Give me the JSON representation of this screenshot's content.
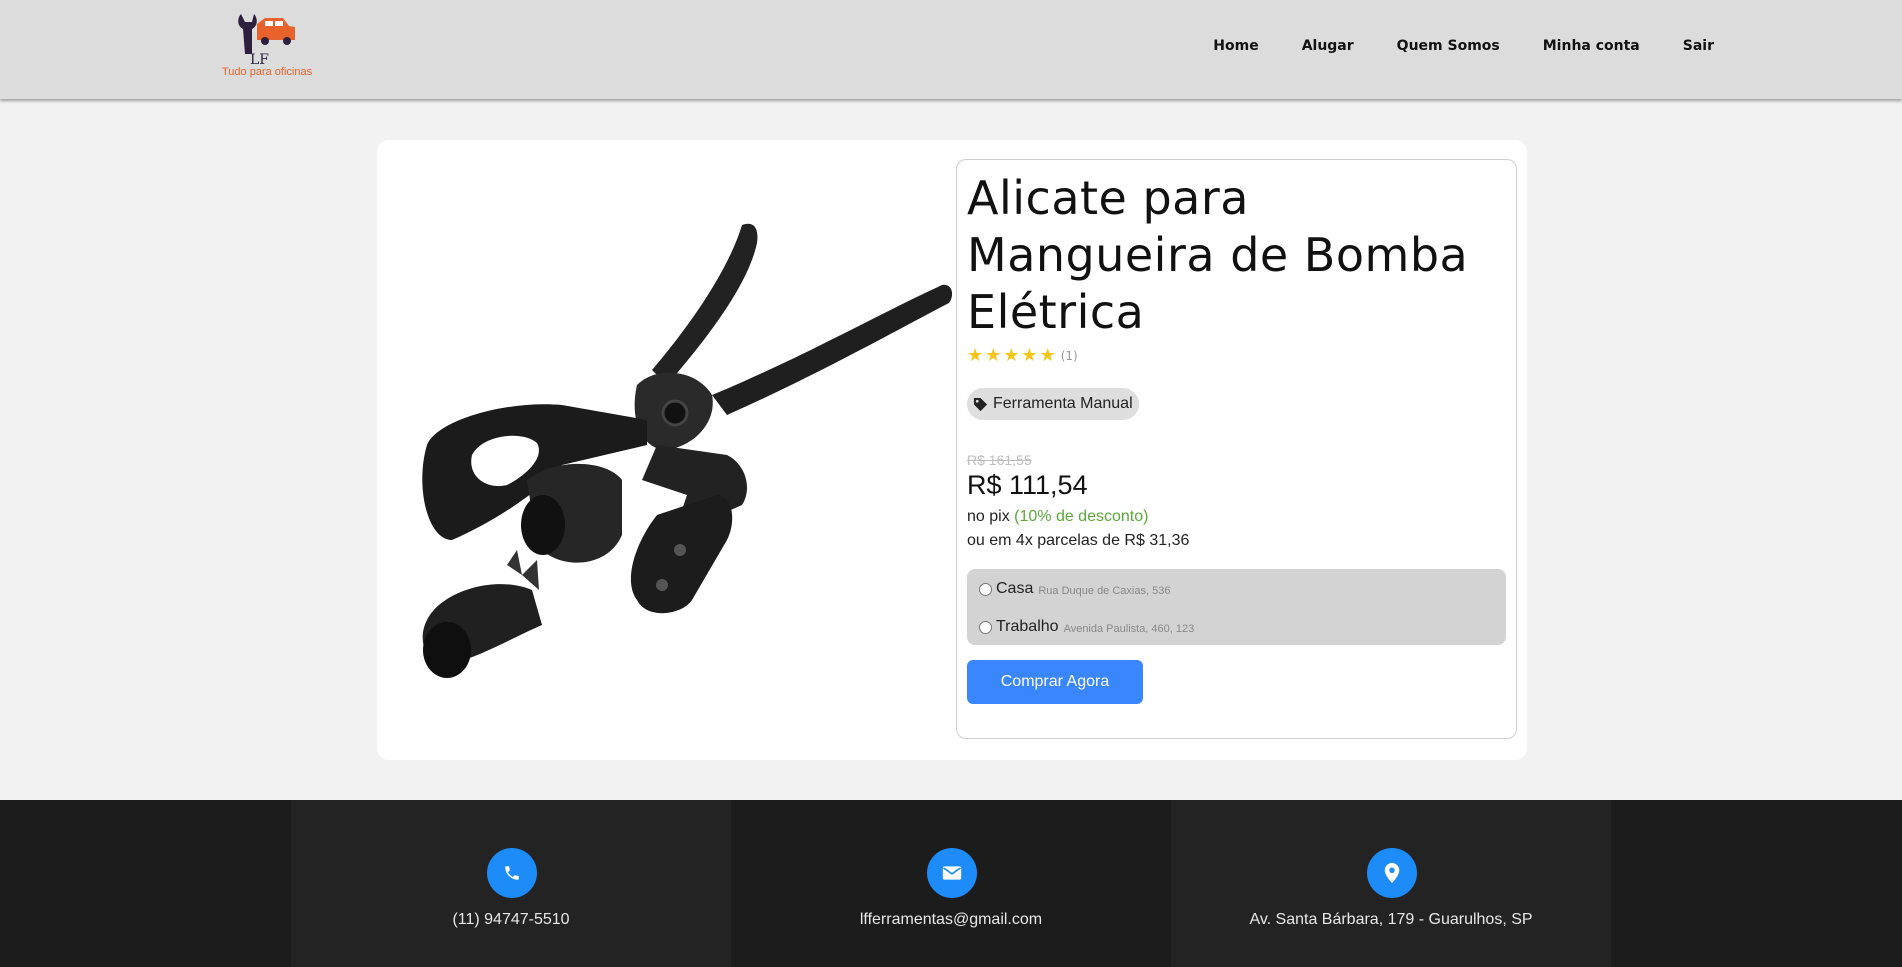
{
  "header": {
    "logo_text": "LF",
    "logo_tagline": "Tudo para oficinas",
    "nav": [
      "Home",
      "Alugar",
      "Quem Somos",
      "Minha conta",
      "Sair"
    ]
  },
  "product": {
    "title": "Alicate para Mangueira de Bomba Elétrica",
    "rating_stars": 5,
    "rating_count": "(1)",
    "category": "Ferramenta Manual",
    "old_price": "R$ 161,55",
    "price": "R$ 111,54",
    "pix_prefix": "no pix ",
    "pix_discount": "(10% de desconto)",
    "installments": "ou em 4x parcelas de R$ 31,36",
    "addresses": [
      {
        "name": "Casa",
        "detail": "Rua Duque de Caxias, 536"
      },
      {
        "name": "Trabalho",
        "detail": "Avenida Paulista, 460, 123"
      }
    ],
    "buy_label": "Comprar Agora"
  },
  "footer": {
    "phone": "(11) 94747-5510",
    "email": "lfferramentas@gmail.com",
    "address": "Av. Santa Bárbara, 179 - Guarulhos, SP"
  },
  "colors": {
    "accent": "#3a86ff",
    "footer_icon": "#1d8cf8",
    "discount": "#5aa83b",
    "star": "#f5c518",
    "logo_orange": "#e8632b"
  },
  "icons": [
    "wrench-car-logo",
    "tag-icon",
    "star-icon",
    "phone-icon",
    "mail-icon",
    "location-pin-icon"
  ]
}
